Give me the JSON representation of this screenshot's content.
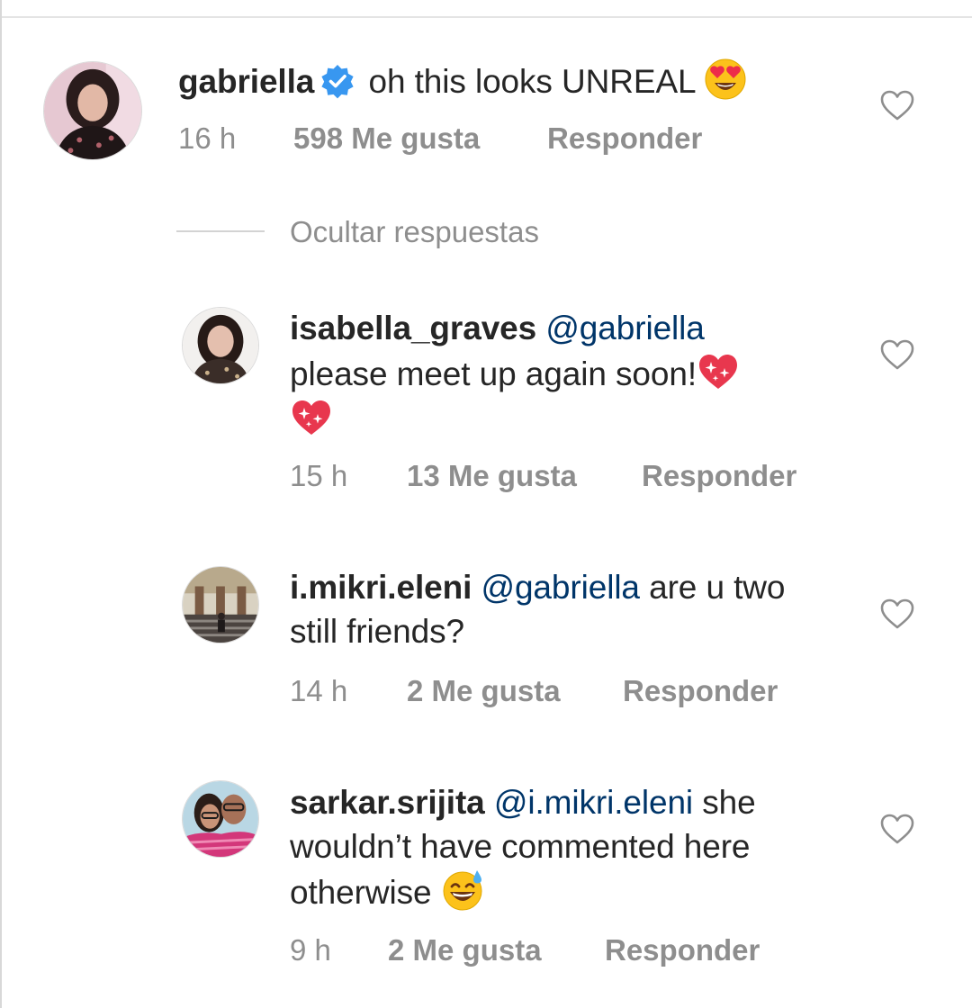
{
  "comment": {
    "username": "gabriella",
    "verified": true,
    "text": "oh this looks UNREAL",
    "emoji": "heart-eyes-emoji",
    "time": "16 h",
    "likes": "598 Me gusta",
    "reply_label": "Responder"
  },
  "hide_replies_label": "Ocultar respuestas",
  "replies": [
    {
      "username": "isabella_graves",
      "mention": "@gabriella",
      "line1_rest": "",
      "line2": "please meet up again soon!",
      "emoji": "sparkling-heart-emoji",
      "time": "15 h",
      "likes": "13 Me gusta",
      "reply_label": "Responder"
    },
    {
      "username": "i.mikri.eleni",
      "mention": "@gabriella",
      "line1_rest": "are u two",
      "line2": "still friends?",
      "time": "14 h",
      "likes": "2 Me gusta",
      "reply_label": "Responder"
    },
    {
      "username": "sarkar.srijita",
      "mention": "@i.mikri.eleni",
      "line1_rest": "she",
      "line2": "wouldn’t have commented here",
      "line3": "otherwise",
      "emoji": "grinning-sweat-emoji",
      "time": "9 h",
      "likes": "2 Me gusta",
      "reply_label": "Responder"
    }
  ],
  "colors": {
    "text": "#262626",
    "meta": "#8e8e8e",
    "mention": "#003569",
    "verified": "#3897f0"
  }
}
